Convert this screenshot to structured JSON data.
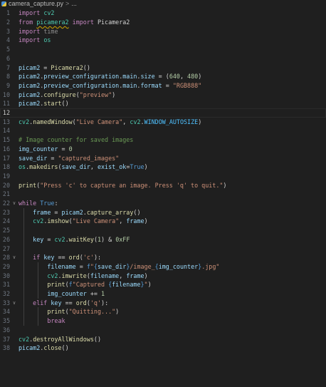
{
  "breadcrumb": {
    "file": "camera_capture.py",
    "separator": ">",
    "more": "..."
  },
  "editor": {
    "current_line": 12,
    "lines": [
      {
        "n": "1",
        "t": [
          [
            "kw",
            "import"
          ],
          [
            "plain",
            " "
          ],
          [
            "mod",
            "cv2"
          ]
        ]
      },
      {
        "n": "2",
        "t": [
          [
            "kw",
            "from"
          ],
          [
            "plain",
            " "
          ],
          [
            "mod_squig",
            "picamera2"
          ],
          [
            "plain",
            " "
          ],
          [
            "kw",
            "import"
          ],
          [
            "plain",
            " "
          ],
          [
            "plain",
            "Picamera2"
          ]
        ]
      },
      {
        "n": "3",
        "t": [
          [
            "kw",
            "import"
          ],
          [
            "plain",
            " "
          ],
          [
            "unused",
            "time"
          ]
        ]
      },
      {
        "n": "4",
        "t": [
          [
            "kw",
            "import"
          ],
          [
            "plain",
            " "
          ],
          [
            "mod",
            "os"
          ]
        ]
      },
      {
        "n": "5",
        "t": []
      },
      {
        "n": "6",
        "t": []
      },
      {
        "n": "7",
        "t": [
          [
            "var",
            "picam2"
          ],
          [
            "plain",
            " = "
          ],
          [
            "fn",
            "Picamera2"
          ],
          [
            "plain",
            "()"
          ]
        ]
      },
      {
        "n": "8",
        "t": [
          [
            "var",
            "picam2"
          ],
          [
            "plain",
            "."
          ],
          [
            "var",
            "preview_configuration"
          ],
          [
            "plain",
            "."
          ],
          [
            "var",
            "main"
          ],
          [
            "plain",
            "."
          ],
          [
            "var",
            "size"
          ],
          [
            "plain",
            " = ("
          ],
          [
            "num",
            "640"
          ],
          [
            "plain",
            ", "
          ],
          [
            "num",
            "480"
          ],
          [
            "plain",
            ")"
          ]
        ]
      },
      {
        "n": "9",
        "t": [
          [
            "var",
            "picam2"
          ],
          [
            "plain",
            "."
          ],
          [
            "var",
            "preview_configuration"
          ],
          [
            "plain",
            "."
          ],
          [
            "var",
            "main"
          ],
          [
            "plain",
            "."
          ],
          [
            "var",
            "format"
          ],
          [
            "plain",
            " = "
          ],
          [
            "str",
            "\"RGB888\""
          ]
        ]
      },
      {
        "n": "10",
        "t": [
          [
            "var",
            "picam2"
          ],
          [
            "plain",
            "."
          ],
          [
            "fn",
            "configure"
          ],
          [
            "plain",
            "("
          ],
          [
            "str",
            "\"preview\""
          ],
          [
            "plain",
            ")"
          ]
        ]
      },
      {
        "n": "11",
        "t": [
          [
            "var",
            "picam2"
          ],
          [
            "plain",
            "."
          ],
          [
            "fn",
            "start"
          ],
          [
            "plain",
            "()"
          ]
        ]
      },
      {
        "n": "12",
        "t": []
      },
      {
        "n": "13",
        "t": [
          [
            "mod",
            "cv2"
          ],
          [
            "plain",
            "."
          ],
          [
            "fn",
            "namedWindow"
          ],
          [
            "plain",
            "("
          ],
          [
            "str",
            "\"Live Camera\""
          ],
          [
            "plain",
            ", "
          ],
          [
            "mod",
            "cv2"
          ],
          [
            "plain",
            "."
          ],
          [
            "const",
            "WINDOW_AUTOSIZE"
          ],
          [
            "plain",
            ")"
          ]
        ]
      },
      {
        "n": "14",
        "t": []
      },
      {
        "n": "15",
        "t": [
          [
            "cmt",
            "# Image counter for saved images"
          ]
        ]
      },
      {
        "n": "16",
        "t": [
          [
            "var",
            "img_counter"
          ],
          [
            "plain",
            " = "
          ],
          [
            "num",
            "0"
          ]
        ]
      },
      {
        "n": "17",
        "t": [
          [
            "var",
            "save_dir"
          ],
          [
            "plain",
            " = "
          ],
          [
            "str",
            "\"captured_images\""
          ]
        ]
      },
      {
        "n": "18",
        "t": [
          [
            "mod",
            "os"
          ],
          [
            "plain",
            "."
          ],
          [
            "fn",
            "makedirs"
          ],
          [
            "plain",
            "("
          ],
          [
            "var",
            "save_dir"
          ],
          [
            "plain",
            ", "
          ],
          [
            "var",
            "exist_ok"
          ],
          [
            "plain",
            "="
          ],
          [
            "bool",
            "True"
          ],
          [
            "plain",
            ")"
          ]
        ]
      },
      {
        "n": "19",
        "t": []
      },
      {
        "n": "20",
        "t": [
          [
            "fn",
            "print"
          ],
          [
            "plain",
            "("
          ],
          [
            "str",
            "\"Press 'c' to capture an image. Press 'q' to quit.\""
          ],
          [
            "plain",
            ")"
          ]
        ]
      },
      {
        "n": "21",
        "t": []
      },
      {
        "n": "22",
        "fold": "v",
        "t": [
          [
            "kw",
            "while"
          ],
          [
            "plain",
            " "
          ],
          [
            "bool",
            "True"
          ],
          [
            "plain",
            ":"
          ]
        ]
      },
      {
        "n": "23",
        "t": [
          [
            "plain",
            "    "
          ],
          [
            "var",
            "frame"
          ],
          [
            "plain",
            " = "
          ],
          [
            "var",
            "picam2"
          ],
          [
            "plain",
            "."
          ],
          [
            "fn",
            "capture_array"
          ],
          [
            "plain",
            "()"
          ]
        ]
      },
      {
        "n": "24",
        "t": [
          [
            "plain",
            "    "
          ],
          [
            "mod",
            "cv2"
          ],
          [
            "plain",
            "."
          ],
          [
            "fn",
            "imshow"
          ],
          [
            "plain",
            "("
          ],
          [
            "str",
            "\"Live Camera\""
          ],
          [
            "plain",
            ", "
          ],
          [
            "var",
            "frame"
          ],
          [
            "plain",
            ")"
          ]
        ]
      },
      {
        "n": "25",
        "t": []
      },
      {
        "n": "26",
        "t": [
          [
            "plain",
            "    "
          ],
          [
            "var",
            "key"
          ],
          [
            "plain",
            " = "
          ],
          [
            "mod",
            "cv2"
          ],
          [
            "plain",
            "."
          ],
          [
            "fn",
            "waitKey"
          ],
          [
            "plain",
            "("
          ],
          [
            "num",
            "1"
          ],
          [
            "plain",
            ") & "
          ],
          [
            "num",
            "0xFF"
          ]
        ]
      },
      {
        "n": "27",
        "t": []
      },
      {
        "n": "28",
        "fold": "v",
        "t": [
          [
            "plain",
            "    "
          ],
          [
            "kw",
            "if"
          ],
          [
            "plain",
            " "
          ],
          [
            "var",
            "key"
          ],
          [
            "plain",
            " == "
          ],
          [
            "fn",
            "ord"
          ],
          [
            "plain",
            "("
          ],
          [
            "str",
            "'c'"
          ],
          [
            "plain",
            "):"
          ]
        ]
      },
      {
        "n": "29",
        "t": [
          [
            "plain",
            "        "
          ],
          [
            "var",
            "filename"
          ],
          [
            "plain",
            " = "
          ],
          [
            "bool",
            "f"
          ],
          [
            "str",
            "\""
          ],
          [
            "brace",
            "{"
          ],
          [
            "var",
            "save_dir"
          ],
          [
            "brace",
            "}"
          ],
          [
            "str",
            "/image_"
          ],
          [
            "brace",
            "{"
          ],
          [
            "var",
            "img_counter"
          ],
          [
            "brace",
            "}"
          ],
          [
            "str",
            ".jpg\""
          ]
        ]
      },
      {
        "n": "30",
        "t": [
          [
            "plain",
            "        "
          ],
          [
            "mod",
            "cv2"
          ],
          [
            "plain",
            "."
          ],
          [
            "fn",
            "imwrite"
          ],
          [
            "plain",
            "("
          ],
          [
            "var",
            "filename"
          ],
          [
            "plain",
            ", "
          ],
          [
            "var",
            "frame"
          ],
          [
            "plain",
            ")"
          ]
        ]
      },
      {
        "n": "31",
        "t": [
          [
            "plain",
            "        "
          ],
          [
            "fn",
            "print"
          ],
          [
            "plain",
            "("
          ],
          [
            "bool",
            "f"
          ],
          [
            "str",
            "\"Captured "
          ],
          [
            "brace",
            "{"
          ],
          [
            "var",
            "filename"
          ],
          [
            "brace",
            "}"
          ],
          [
            "str",
            "\""
          ],
          [
            "plain",
            ")"
          ]
        ]
      },
      {
        "n": "32",
        "t": [
          [
            "plain",
            "        "
          ],
          [
            "var",
            "img_counter"
          ],
          [
            "plain",
            " += "
          ],
          [
            "num",
            "1"
          ]
        ]
      },
      {
        "n": "33",
        "fold": "v",
        "t": [
          [
            "plain",
            "    "
          ],
          [
            "kw",
            "elif"
          ],
          [
            "plain",
            " "
          ],
          [
            "var",
            "key"
          ],
          [
            "plain",
            " == "
          ],
          [
            "fn",
            "ord"
          ],
          [
            "plain",
            "("
          ],
          [
            "str",
            "'q'"
          ],
          [
            "plain",
            "):"
          ]
        ]
      },
      {
        "n": "34",
        "t": [
          [
            "plain",
            "        "
          ],
          [
            "fn",
            "print"
          ],
          [
            "plain",
            "("
          ],
          [
            "str",
            "\"Quitting...\""
          ],
          [
            "plain",
            ")"
          ]
        ]
      },
      {
        "n": "35",
        "t": [
          [
            "plain",
            "        "
          ],
          [
            "kw",
            "break"
          ]
        ]
      },
      {
        "n": "36",
        "t": []
      },
      {
        "n": "37",
        "t": [
          [
            "mod",
            "cv2"
          ],
          [
            "plain",
            "."
          ],
          [
            "fn",
            "destroyAllWindows"
          ],
          [
            "plain",
            "()"
          ]
        ]
      },
      {
        "n": "38",
        "t": [
          [
            "var",
            "picam2"
          ],
          [
            "plain",
            "."
          ],
          [
            "fn",
            "close"
          ],
          [
            "plain",
            "()"
          ]
        ]
      }
    ]
  }
}
